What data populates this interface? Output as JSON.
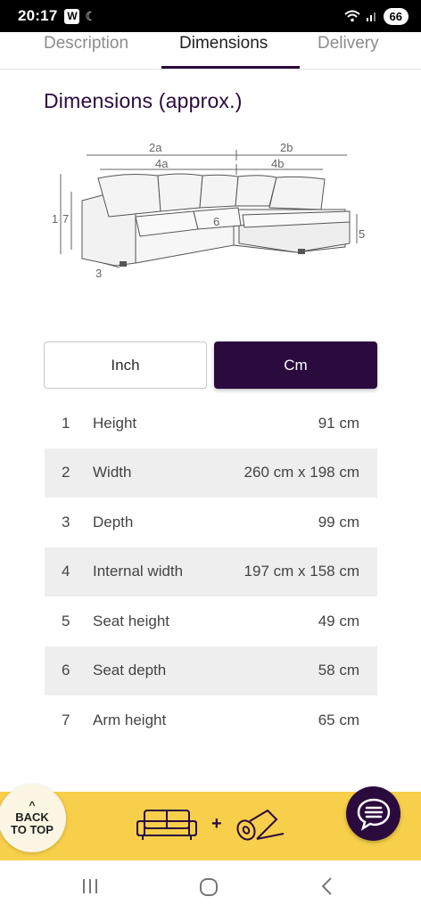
{
  "status": {
    "time": "20:17",
    "w_badge": "W",
    "battery": "66"
  },
  "tabs": [
    {
      "label": "Description"
    },
    {
      "label": "Dimensions"
    },
    {
      "label": "Delivery"
    }
  ],
  "section_title": "Dimensions (approx.)",
  "diagram": {
    "labels": {
      "l2a": "2a",
      "l4a": "4a",
      "l2b": "2b",
      "l4b": "4b",
      "l1": "1",
      "l7": "7",
      "l3": "3",
      "l6": "6",
      "l5": "5"
    }
  },
  "units": {
    "inch": "Inch",
    "cm": "Cm",
    "selected": "Cm"
  },
  "dimensions": [
    {
      "num": "1",
      "label": "Height",
      "value": "91 cm"
    },
    {
      "num": "2",
      "label": "Width",
      "value": "260 cm x 198 cm"
    },
    {
      "num": "3",
      "label": "Depth",
      "value": "99 cm"
    },
    {
      "num": "4",
      "label": "Internal width",
      "value": "197 cm x 158 cm"
    },
    {
      "num": "5",
      "label": "Seat height",
      "value": "49 cm"
    },
    {
      "num": "6",
      "label": "Seat depth",
      "value": "58 cm"
    },
    {
      "num": "7",
      "label": "Arm height",
      "value": "65 cm"
    }
  ],
  "back_to_top": {
    "line1": "BACK",
    "line2": "TO TOP"
  },
  "promo": {
    "plus": "+"
  },
  "colors": {
    "brand": "#2b0a3d",
    "promo_bg": "#f7cf4a",
    "row_shade": "#eeeeee"
  }
}
